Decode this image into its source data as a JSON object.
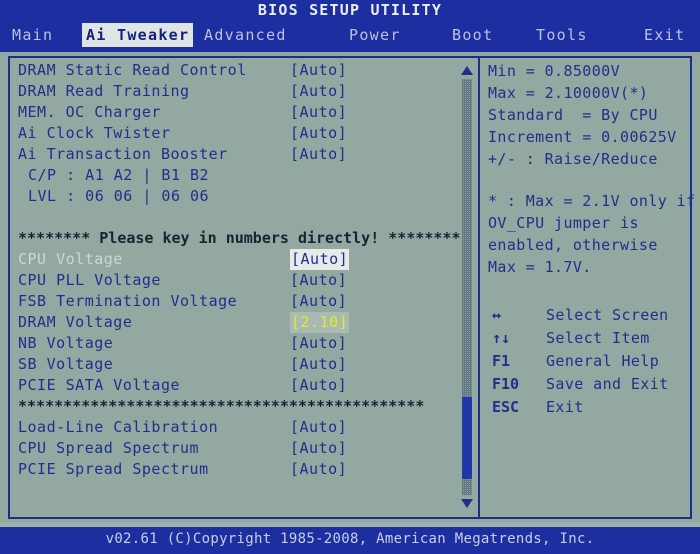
{
  "header": {
    "title": "BIOS SETUP UTILITY"
  },
  "tabs": [
    {
      "label": "Main",
      "active": false
    },
    {
      "label": "Ai Tweaker",
      "active": true
    },
    {
      "label": "Advanced",
      "active": false
    },
    {
      "label": "Power",
      "active": false
    },
    {
      "label": "Boot",
      "active": false
    },
    {
      "label": "Tools",
      "active": false
    },
    {
      "label": "Exit",
      "active": false
    }
  ],
  "settings": [
    {
      "label": "DRAM Static Read Control",
      "value": "[Auto]",
      "state": "normal"
    },
    {
      "label": "DRAM Read Training",
      "value": "[Auto]",
      "state": "normal"
    },
    {
      "label": "MEM. OC Charger",
      "value": "[Auto]",
      "state": "normal"
    },
    {
      "label": "Ai Clock Twister",
      "value": "[Auto]",
      "state": "normal"
    },
    {
      "label": "Ai Transaction Booster",
      "value": "[Auto]",
      "state": "normal"
    },
    {
      "label": "C/P : A1 A2 | B1 B2",
      "value": "",
      "state": "indent"
    },
    {
      "label": "LVL : 06 06 | 06 06",
      "value": "",
      "state": "indent"
    },
    {
      "label": "",
      "value": "",
      "state": "blank"
    },
    {
      "label": "******** Please key in numbers directly! ********",
      "value": "",
      "state": "sep"
    },
    {
      "label": "CPU Voltage",
      "value": "[Auto]",
      "state": "dim"
    },
    {
      "label": "CPU PLL Voltage",
      "value": "[Auto]",
      "state": "normal"
    },
    {
      "label": "FSB Termination Voltage",
      "value": "[Auto]",
      "state": "normal"
    },
    {
      "label": "DRAM Voltage",
      "value": "[2.10]",
      "state": "edit"
    },
    {
      "label": "NB Voltage",
      "value": "[Auto]",
      "state": "normal"
    },
    {
      "label": "SB Voltage",
      "value": "[Auto]",
      "state": "normal"
    },
    {
      "label": "PCIE SATA Voltage",
      "value": "[Auto]",
      "state": "normal"
    },
    {
      "label": "*********************************************",
      "value": "",
      "state": "sep"
    },
    {
      "label": "Load-Line Calibration",
      "value": "[Auto]",
      "state": "normal"
    },
    {
      "label": "CPU Spread Spectrum",
      "value": "[Auto]",
      "state": "normal"
    },
    {
      "label": "PCIE Spread Spectrum",
      "value": "[Auto]",
      "state": "normal"
    }
  ],
  "scrollbar": {
    "up_arrow": "triangle-up-icon",
    "down_arrow": "triangle-down-icon",
    "thumb_position_percent": 80
  },
  "help": {
    "lines": [
      "Min = 0.85000V",
      "Max = 2.10000V(*)",
      "Standard  = By CPU",
      "Increment = 0.00625V",
      "+/- : Raise/Reduce"
    ],
    "note_lines": [
      "* : Max = 2.1V only if",
      "OV_CPU jumper is",
      "enabled, otherwise",
      "Max = 1.7V."
    ]
  },
  "legend": [
    {
      "key": "↔",
      "desc": "Select Screen"
    },
    {
      "key": "↑↓",
      "desc": "Select Item"
    },
    {
      "key": "F1",
      "desc": "General Help"
    },
    {
      "key": "F10",
      "desc": "Save and Exit"
    },
    {
      "key": "ESC",
      "desc": "Exit"
    }
  ],
  "footer": {
    "text": "v02.61 (C)Copyright 1985-2008, American Megatrends, Inc."
  },
  "colors": {
    "background": "#93a8a1",
    "bar_blue": "#1d2ea0",
    "text_blue": "#1d308e",
    "edit_yellow": "#e8e823",
    "active_tab_bg": "#dfe5e4"
  }
}
